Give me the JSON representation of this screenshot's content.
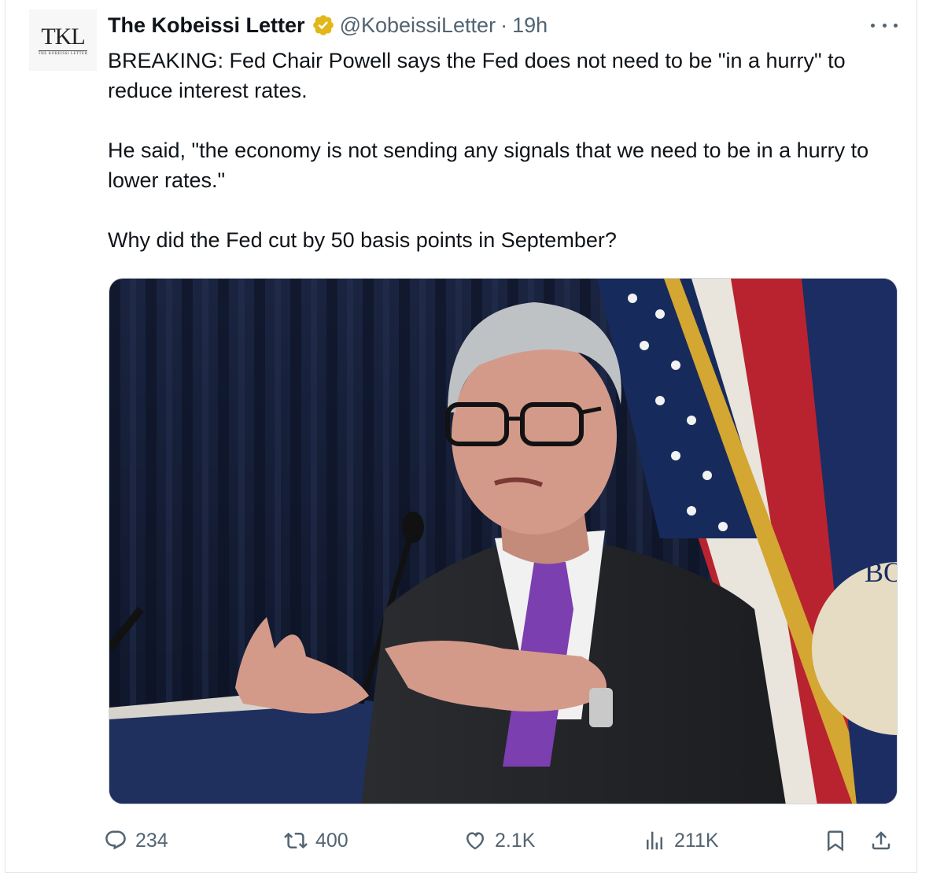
{
  "tweet": {
    "avatar_monogram": "TKL",
    "avatar_subtext": "THE KOBEISSI LETTER",
    "display_name": "The Kobeissi Letter",
    "verified_icon": "gold-verified-badge-icon",
    "handle": "@KobeissiLetter",
    "separator": "·",
    "time": "19h",
    "more_icon": "more-horizontal-icon",
    "paragraphs": [
      "BREAKING: Fed Chair Powell says the Fed does not need to be \"in a hurry\" to reduce interest rates.",
      "He said, \"the economy is not sending any signals that we need to be in a hurry to lower rates.\"",
      "Why did the Fed cut by 50 basis points in September?"
    ],
    "media": {
      "description_icon": "photo",
      "seal_text": "BO"
    }
  },
  "actions": {
    "reply": {
      "icon": "reply-icon",
      "count": "234"
    },
    "repost": {
      "icon": "repost-icon",
      "count": "400"
    },
    "like": {
      "icon": "heart-icon",
      "count": "2.1K"
    },
    "views": {
      "icon": "views-icon",
      "count": "211K"
    },
    "bookmark": {
      "icon": "bookmark-icon"
    },
    "share": {
      "icon": "share-icon"
    }
  },
  "colors": {
    "text": "#0f1419",
    "secondary": "#536471",
    "verified": "#e2b719",
    "border": "#cfd9de"
  }
}
